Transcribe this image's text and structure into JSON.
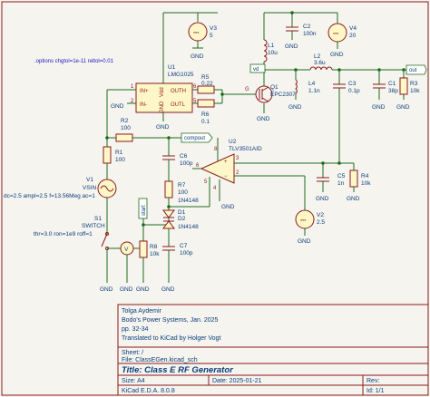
{
  "title_block": {
    "author": "Tolga Aydemir",
    "source": "Bodo's Power Systems, Jan. 2025",
    "pages": "pp. 32-34",
    "translator": "Translated to KiCad by Holger Vogt",
    "sheet": "Sheet: /",
    "file": "File: ClassEGen.kicad_sch",
    "title": "Title: Class E RF Generator",
    "size": "Size: A4",
    "date": "Date: 2025-01-21",
    "rev": "Rev:",
    "tool": "KiCad E.D.A. 8.0.8",
    "id": "Id: 1/1"
  },
  "spice_options": ".options chgtol=1e-11 reltol=0.01",
  "net_labels": {
    "compout": "compout",
    "vd": "vd",
    "out": "out",
    "start": "start"
  },
  "components": {
    "U1": {
      "ref": "U1",
      "value": "LMG1025",
      "pins": {
        "in_p": "IN+",
        "in_n": "IN-",
        "vdd": "Vdd",
        "gnd": "GND",
        "outh": "OUTH",
        "outl": "OUTL",
        "p1": "1",
        "p2": "2",
        "p3": "3",
        "p4": "4",
        "p5": "5",
        "p6": "6"
      }
    },
    "U2": {
      "ref": "U2",
      "value": "TLV3501AID",
      "pins": {
        "p1": "1",
        "p2": "2",
        "p3": "3",
        "p4": "4",
        "p5": "5",
        "p6": "6",
        "p8": "8"
      }
    },
    "Q1": {
      "ref": "Q1",
      "value": "EPC2307"
    },
    "V1": {
      "ref": "V1",
      "value": "VSIN",
      "spec": "dc=2.5 ampl=2.5 f=13.56Meg ac=1"
    },
    "V2": {
      "ref": "V2",
      "value": "2.5"
    },
    "V3": {
      "ref": "V3",
      "value": "5"
    },
    "V4": {
      "ref": "V4",
      "value": "20"
    },
    "S1": {
      "ref": "S1",
      "value": "SWITCH",
      "spec": "thr=3.0 ron=1e9 roff=1"
    },
    "R1": {
      "ref": "R1",
      "value": "100"
    },
    "R2": {
      "ref": "R2",
      "value": "100"
    },
    "R3": {
      "ref": "R3",
      "value": "10k"
    },
    "R4": {
      "ref": "R4",
      "value": "10k"
    },
    "R5": {
      "ref": "R5",
      "value": "0.22"
    },
    "R6": {
      "ref": "R6",
      "value": "0.1"
    },
    "R7": {
      "ref": "R7",
      "value": "100"
    },
    "R8": {
      "ref": "R8",
      "value": "10k"
    },
    "C1": {
      "ref": "C1",
      "value": "38p"
    },
    "C2": {
      "ref": "C2",
      "value": "100n"
    },
    "C3": {
      "ref": "C3",
      "value": "0.1p"
    },
    "C5": {
      "ref": "C5",
      "value": "1n"
    },
    "C6": {
      "ref": "C6",
      "value": "100p"
    },
    "C7": {
      "ref": "C7",
      "value": "100p"
    },
    "L1": {
      "ref": "L1",
      "value": "10u"
    },
    "L2": {
      "ref": "L2",
      "value": "3.6u"
    },
    "L4": {
      "ref": "L4",
      "value": "1.1n"
    },
    "D1": {
      "ref": "D1",
      "value": "1N4148"
    },
    "D2": {
      "ref": "D2",
      "value": "1N4148"
    },
    "VM": {
      "ref": "V"
    }
  },
  "gnd_label": "GND"
}
